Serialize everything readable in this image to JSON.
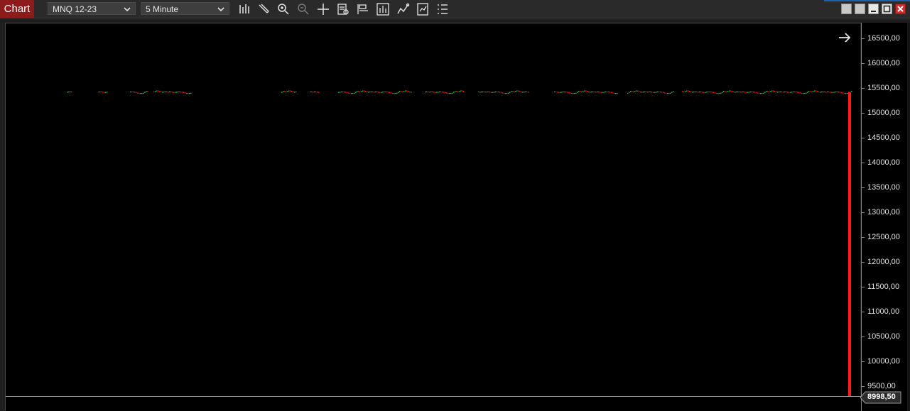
{
  "app": {
    "tab_label": "Chart"
  },
  "toolbar": {
    "instrument": "MNQ 12-23",
    "interval": "5 Minute",
    "icons": [
      "bar-chart-icon",
      "draw-pencil-icon",
      "zoom-in-icon",
      "zoom-out-icon",
      "crosshair-icon",
      "data-box-icon",
      "chart-trader-icon",
      "indicators-icon",
      "strategies-icon",
      "properties-icon",
      "list-icon"
    ]
  },
  "window_controls": [
    "tile-icon",
    "restore-small-icon",
    "minimize-icon",
    "maximize-icon",
    "close-icon"
  ],
  "colors": {
    "up": "#22cc44",
    "down": "#ff1a1a",
    "accent_tab": "#8e1b1b",
    "background": "#000000"
  },
  "chart_data": {
    "type": "bar",
    "instrument": "MNQ 12-23",
    "interval": "5 Minute",
    "ylim": [
      9300,
      16800
    ],
    "y_ticks": [
      "16500,00",
      "16000,00",
      "15500,00",
      "15000,00",
      "14500,00",
      "14000,00",
      "13500,00",
      "13000,00",
      "12500,00",
      "12000,00",
      "11500,00",
      "11000,00",
      "10500,00",
      "10000,00",
      "9500,00"
    ],
    "price_levels": [
      16500,
      16000,
      15500,
      15000,
      14500,
      14000,
      13500,
      13000,
      12500,
      12000,
      11500,
      11000,
      10500,
      10000,
      9500
    ],
    "last_price_label": "8998,50",
    "last_price": 8998.5,
    "price_series_approx": [
      15420,
      15425,
      15428,
      15430,
      15426,
      15422,
      15430,
      15425,
      15420,
      15418,
      15420,
      15425,
      15430,
      15428,
      15424,
      15420,
      15410,
      15400,
      15395,
      15398,
      15400,
      15405,
      15420,
      15440,
      15430,
      15425,
      15440,
      15450,
      15445,
      15430
    ],
    "final_bar": {
      "open": 15420,
      "close": 8998.5,
      "direction": "down"
    }
  }
}
